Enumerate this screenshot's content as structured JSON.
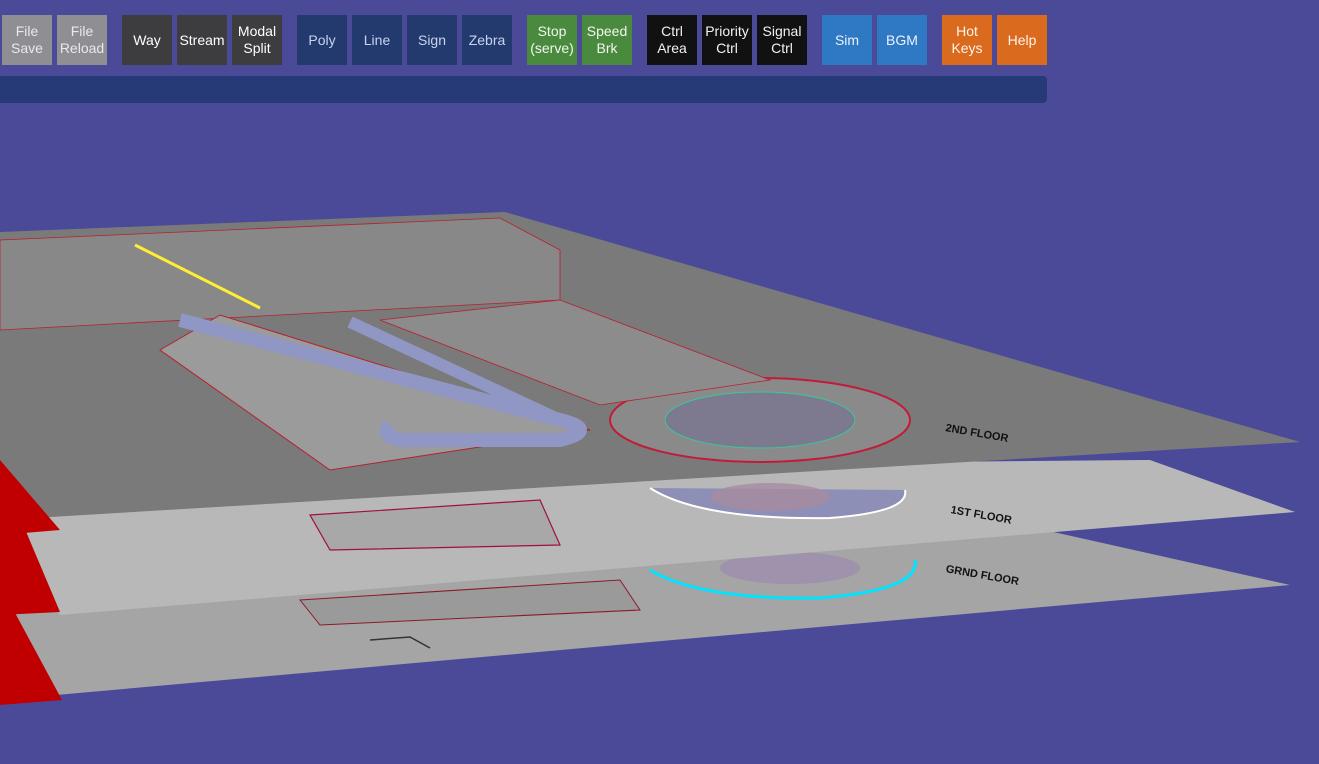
{
  "toolbar": {
    "file_save": "File\nSave",
    "file_reload": "File\nReload",
    "way": "Way",
    "stream": "Stream",
    "modal_split": "Modal\nSplit",
    "poly": "Poly",
    "line": "Line",
    "sign": "Sign",
    "zebra": "Zebra",
    "stop_serve": "Stop\n(serve)",
    "speed_brk": "Speed\nBrk",
    "ctrl_area": "Ctrl\nArea",
    "priority_ctrl": "Priority\nCtrl",
    "signal_ctrl": "Signal\nCtrl",
    "sim": "Sim",
    "bgm": "BGM",
    "hot_keys": "Hot\nKeys",
    "help": "Help"
  },
  "colors": {
    "background": "#4b4a98",
    "command_bar": "#263a78",
    "file_group": "#8e8e93",
    "way_group": "#3d3d40",
    "poly_group": "#233a6e",
    "stop_group": "#4a8a3e",
    "ctrl_group": "#111111",
    "sim_group": "#2f79c4",
    "help_group": "#d96a1e"
  },
  "scene": {
    "description_icons": [
      "floor-plan-layer",
      "parking-bays",
      "driveway-loop"
    ]
  }
}
